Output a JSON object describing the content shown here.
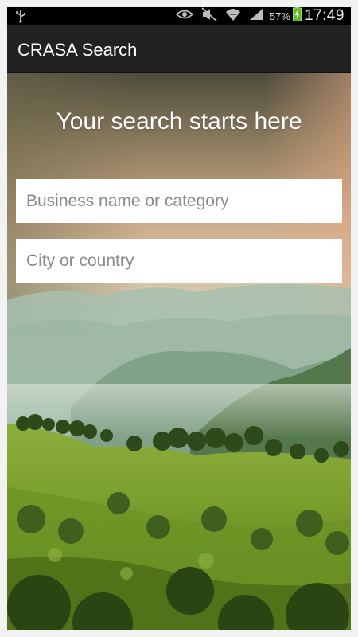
{
  "status_bar": {
    "battery_percent": "57%",
    "time": "17:49",
    "icons": [
      "usb-icon",
      "eye-icon",
      "mute-icon",
      "wifi-icon",
      "signal-icon",
      "battery-charging-icon"
    ]
  },
  "action_bar": {
    "title": "CRASA Search"
  },
  "main": {
    "headline": "Your search starts here",
    "business_field": {
      "placeholder": "Business name or category",
      "value": ""
    },
    "location_field": {
      "placeholder": "City or country",
      "value": ""
    }
  }
}
